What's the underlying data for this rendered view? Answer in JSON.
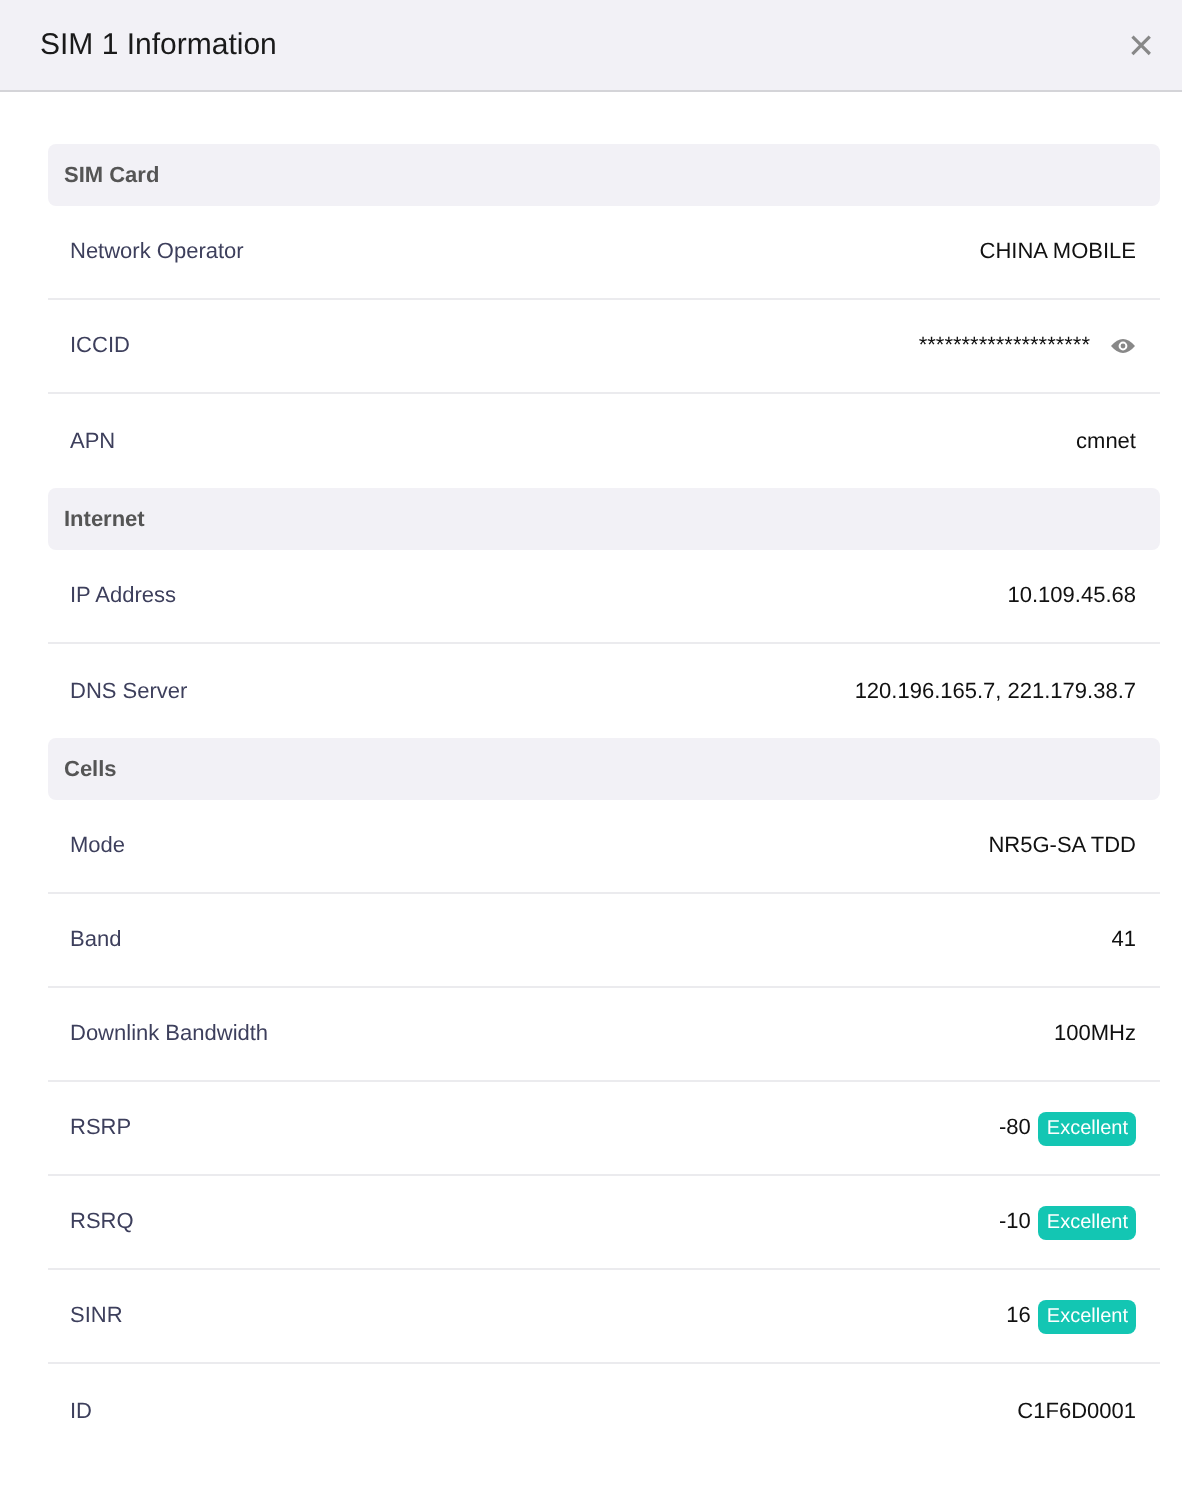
{
  "dialog": {
    "title": "SIM 1 Information",
    "close": "×"
  },
  "sections": [
    {
      "title": "SIM Card",
      "rows": [
        {
          "label": "Network Operator",
          "value": "CHINA MOBILE"
        },
        {
          "label": "ICCID",
          "value": "********************",
          "kind": "secret"
        },
        {
          "label": "APN",
          "value": "cmnet"
        }
      ]
    },
    {
      "title": "Internet",
      "rows": [
        {
          "label": "IP Address",
          "value": "10.109.45.68"
        },
        {
          "label": "DNS Server",
          "value": "120.196.165.7, 221.179.38.7"
        }
      ]
    },
    {
      "title": "Cells",
      "rows": [
        {
          "label": "Mode",
          "value": "NR5G-SA TDD"
        },
        {
          "label": "Band",
          "value": "41"
        },
        {
          "label": "Downlink Bandwidth",
          "value": "100MHz"
        },
        {
          "label": "RSRP",
          "value": "-80",
          "badge": "Excellent"
        },
        {
          "label": "RSRQ",
          "value": "-10",
          "badge": "Excellent"
        },
        {
          "label": "SINR",
          "value": "16",
          "badge": "Excellent"
        },
        {
          "label": "ID",
          "value": "C1F6D0001"
        }
      ]
    }
  ]
}
